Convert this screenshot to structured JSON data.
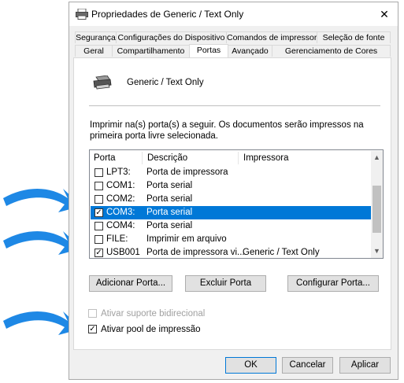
{
  "window": {
    "title": "Propriedades de Generic / Text Only",
    "close": "✕"
  },
  "tabs_row1": [
    {
      "label": "Segurança"
    },
    {
      "label": "Configurações do Dispositivo"
    },
    {
      "label": "Comandos de impressora"
    },
    {
      "label": "Seleção de fonte"
    }
  ],
  "tabs_row2": [
    {
      "label": "Geral"
    },
    {
      "label": "Compartilhamento"
    },
    {
      "label": "Portas"
    },
    {
      "label": "Avançado"
    },
    {
      "label": "Gerenciamento de Cores"
    }
  ],
  "printer_name": "Generic / Text Only",
  "description": "Imprimir na(s) porta(s) a seguir. Os documentos serão impressos na primeira porta livre selecionada.",
  "columns": {
    "port": "Porta",
    "desc": "Descrição",
    "printer": "Impressora"
  },
  "ports": [
    {
      "port": "LPT3:",
      "desc": "Porta de impressora",
      "printer": "",
      "checked": false,
      "selected": false
    },
    {
      "port": "COM1:",
      "desc": "Porta serial",
      "printer": "",
      "checked": false,
      "selected": false
    },
    {
      "port": "COM2:",
      "desc": "Porta serial",
      "printer": "",
      "checked": false,
      "selected": false
    },
    {
      "port": "COM3:",
      "desc": "Porta serial",
      "printer": "",
      "checked": true,
      "selected": true
    },
    {
      "port": "COM4:",
      "desc": "Porta serial",
      "printer": "",
      "checked": false,
      "selected": false
    },
    {
      "port": "FILE:",
      "desc": "Imprimir em arquivo",
      "printer": "",
      "checked": false,
      "selected": false
    },
    {
      "port": "USB001",
      "desc": "Porta de impressora vi...",
      "printer": "Generic / Text Only",
      "checked": true,
      "selected": false
    }
  ],
  "buttons": {
    "add_port": "Adicionar Porta...",
    "delete_port": "Excluir Porta",
    "configure_port": "Configurar Porta...",
    "ok": "OK",
    "cancel": "Cancelar",
    "apply": "Aplicar"
  },
  "options": {
    "bidirectional": {
      "label": "Ativar suporte bidirecional",
      "checked": false,
      "enabled": false
    },
    "pool": {
      "label": "Ativar pool de impressão",
      "checked": true,
      "enabled": true
    }
  },
  "colors": {
    "selection": "#0078d7",
    "arrow": "#1e88e5"
  }
}
